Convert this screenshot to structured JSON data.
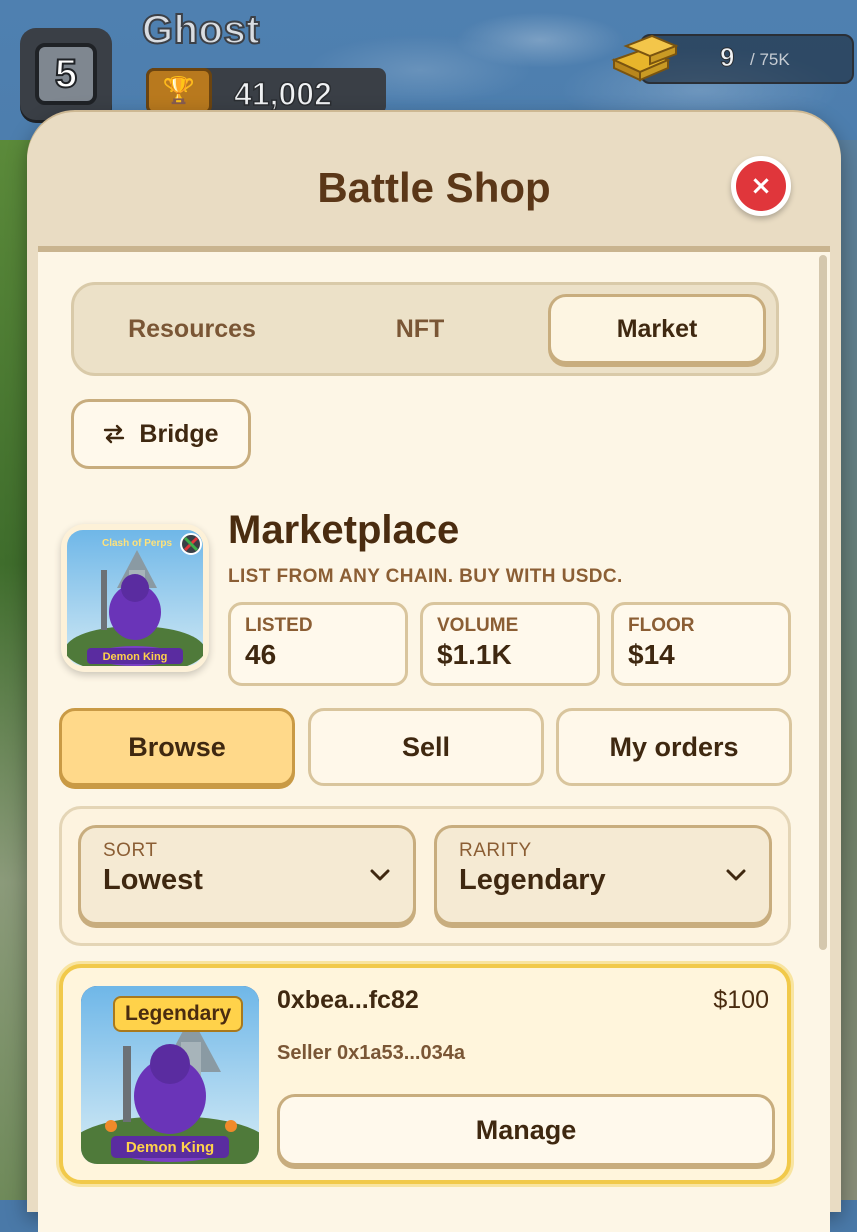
{
  "hud": {
    "level": "5",
    "player_name": "Ghost",
    "trophies": "41,002",
    "gold": "9",
    "gold_cap": "/ 75K"
  },
  "panel": {
    "title": "Battle Shop",
    "close_label": "×"
  },
  "tabs": [
    {
      "label": "Resources",
      "active": false
    },
    {
      "label": "NFT",
      "active": false
    },
    {
      "label": "Market",
      "active": true
    }
  ],
  "bridge": {
    "label": "Bridge",
    "icon": "swap-arrows-icon"
  },
  "marketplace": {
    "thumb_title": "Clash of Perps",
    "thumb_name": "Demon King",
    "title": "Marketplace",
    "subtitle": "LIST FROM ANY CHAIN. BUY WITH USDC.",
    "stats": [
      {
        "label": "LISTED",
        "value": "46"
      },
      {
        "label": "VOLUME",
        "value": "$1.1K"
      },
      {
        "label": "FLOOR",
        "value": "$14"
      }
    ]
  },
  "subtabs": [
    {
      "label": "Browse",
      "active": true
    },
    {
      "label": "Sell",
      "active": false
    },
    {
      "label": "My orders",
      "active": false
    }
  ],
  "filters": {
    "sort": {
      "label": "SORT",
      "value": "Lowest"
    },
    "rarity": {
      "label": "RARITY",
      "value": "Legendary"
    }
  },
  "listing": {
    "rarity": "Legendary",
    "name": "Demon King",
    "token": "0xbea...fc82",
    "price": "$100",
    "seller": "Seller 0x1a53...034a",
    "action": "Manage"
  },
  "colors": {
    "accent": "#ffd98a",
    "close": "#e0363b",
    "text_dark": "#3f2810"
  }
}
